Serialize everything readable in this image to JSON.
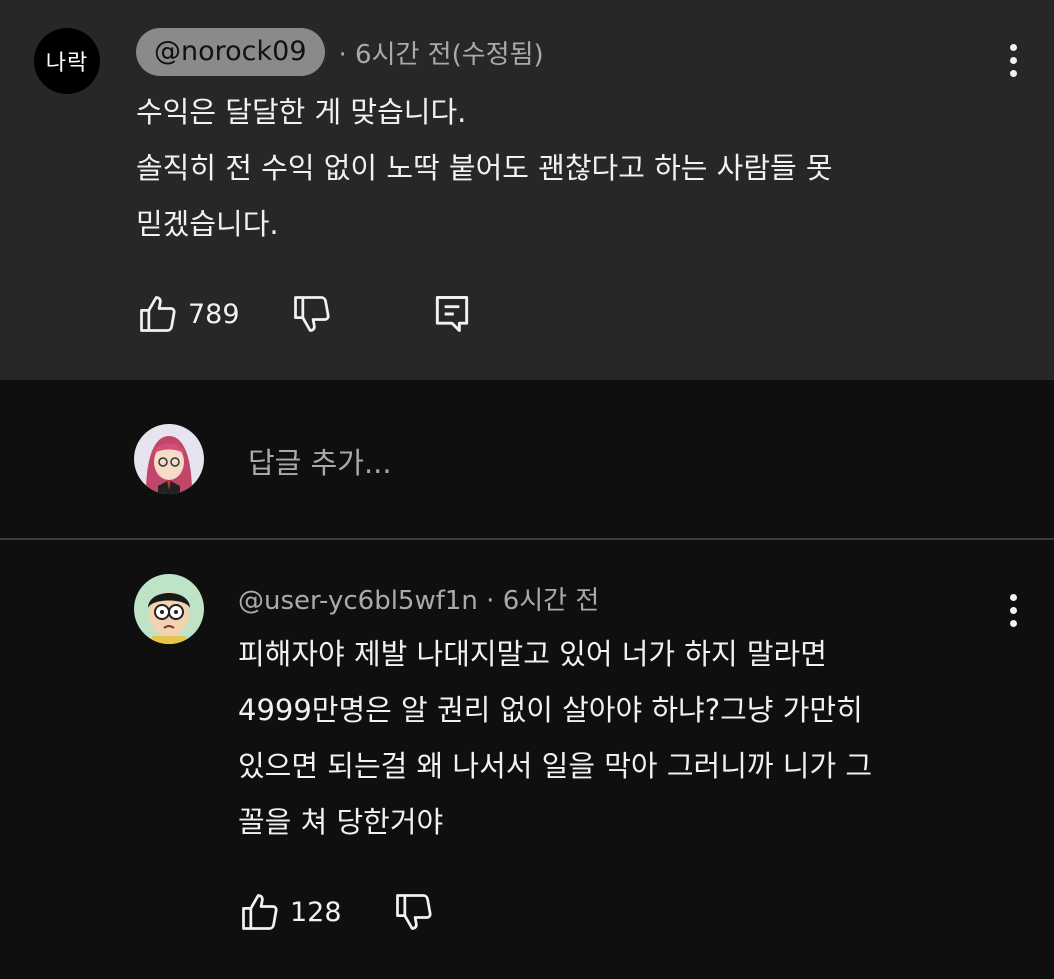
{
  "comment": {
    "avatar_text": "나락",
    "handle": "@norock09",
    "meta": "· 6시간 전(수정됨)",
    "lines": [
      "수익은 달달한 게 맞습니다.",
      "솔직히 전 수익 없이 노딱 붙어도 괜찮다고 하는 사람들 못",
      "믿겠습니다."
    ],
    "likes": "789"
  },
  "reply_input": {
    "placeholder": "답글 추가..."
  },
  "reply": {
    "handle": "@user-yc6bl5wf1n",
    "meta": "· 6시간 전",
    "lines": [
      "피해자야 제발 나대지말고 있어 너가 하지 말라면",
      "4999만명은 알 권리 없이 살아야 하냐?그냥 가만히",
      "있으면 되는걸 왜 나서서 일을 막아 그러니까 니가 그",
      "꼴을 쳐 당한거야"
    ],
    "likes": "128"
  },
  "colors": {
    "top_bg": "#272727",
    "page_bg": "#0f0f0f",
    "secondary_text": "#aaaaaa",
    "pill_bg": "#8a8a8a"
  }
}
